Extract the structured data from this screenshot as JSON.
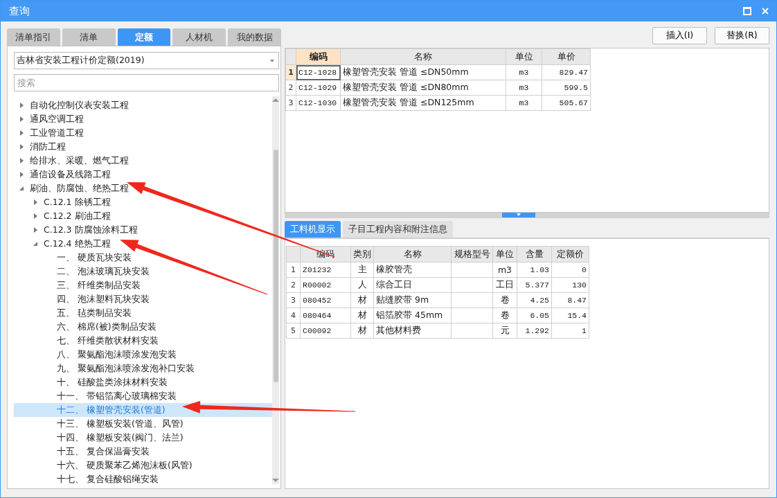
{
  "window": {
    "title": "查询"
  },
  "left_tabs": [
    {
      "label": "清单指引",
      "selected": false
    },
    {
      "label": "清单",
      "selected": false
    },
    {
      "label": "定额",
      "selected": true
    },
    {
      "label": "人材机",
      "selected": false
    },
    {
      "label": "我的数据",
      "selected": false
    }
  ],
  "library_select": {
    "value": "吉林省安装工程计价定额(2019)"
  },
  "search": {
    "placeholder": "搜索"
  },
  "tree": [
    {
      "label": "自动化控制仪表安装工程",
      "expanded": false,
      "selected": false
    },
    {
      "label": "通风空调工程",
      "expanded": false,
      "selected": false
    },
    {
      "label": "工业管道工程",
      "expanded": false,
      "selected": false
    },
    {
      "label": "消防工程",
      "expanded": false,
      "selected": false
    },
    {
      "label": "给排水、采暖、燃气工程",
      "expanded": false,
      "selected": false
    },
    {
      "label": "通信设备及线路工程",
      "expanded": false,
      "selected": false
    },
    {
      "label": "刷油、防腐蚀、绝热工程",
      "expanded": true,
      "selected": false,
      "children": [
        {
          "label": "C.12.1 除锈工程",
          "expanded": false,
          "selected": false
        },
        {
          "label": "C.12.2 刷油工程",
          "expanded": false,
          "selected": false
        },
        {
          "label": "C.12.3 防腐蚀涂料工程",
          "expanded": false,
          "selected": false
        },
        {
          "label": "C.12.4 绝热工程",
          "expanded": true,
          "selected": false,
          "children": [
            {
              "label": "一、 硬质瓦块安装",
              "selected": false
            },
            {
              "label": "二、 泡沫玻璃瓦块安装",
              "selected": false
            },
            {
              "label": "三、 纤维类制品安装",
              "selected": false
            },
            {
              "label": "四、 泡沫塑料瓦块安装",
              "selected": false
            },
            {
              "label": "五、 毡类制品安装",
              "selected": false
            },
            {
              "label": "六、 棉席(被)类制品安装",
              "selected": false
            },
            {
              "label": "七、 纤维类散状材料安装",
              "selected": false
            },
            {
              "label": "八、 聚氨酯泡沫喷涂发泡安装",
              "selected": false
            },
            {
              "label": "九、 聚氨酯泡沫喷涂发泡补口安装",
              "selected": false
            },
            {
              "label": "十、 硅酸盐类涂抹材料安装",
              "selected": false
            },
            {
              "label": "十一、 带铝箔离心玻璃棉安装",
              "selected": false
            },
            {
              "label": "十二、 橡塑管壳安装(管道)",
              "selected": true
            },
            {
              "label": "十三、 橡塑板安装(管道、风管)",
              "selected": false
            },
            {
              "label": "十四、 橡塑板安装(阀门、法兰)",
              "selected": false
            },
            {
              "label": "十五、 复合保温膏安装",
              "selected": false
            },
            {
              "label": "十六、 硬质聚苯乙烯泡沫板(风管)",
              "selected": false
            },
            {
              "label": "十七、 复合硅酸铝绳安装",
              "selected": false
            }
          ]
        }
      ]
    }
  ],
  "actions": [
    "插入(I)",
    "替换(R)"
  ],
  "quota_table": {
    "columns": [
      "编码",
      "名称",
      "单位",
      "单价"
    ],
    "rows": [
      {
        "index": "1",
        "selected": true,
        "cells": [
          "C12-1028",
          "橡塑管壳安装 管道 ≤DN50mm",
          "m3",
          "829.47"
        ]
      },
      {
        "index": "2",
        "selected": false,
        "cells": [
          "C12-1029",
          "橡塑管壳安装 管道 ≤DN80mm",
          "m3",
          "599.5"
        ]
      },
      {
        "index": "3",
        "selected": false,
        "cells": [
          "C12-1030",
          "橡塑管壳安装 管道 ≤DN125mm",
          "m3",
          "505.67"
        ]
      }
    ]
  },
  "detail_tabs": [
    {
      "label": "工料机显示",
      "selected": true
    },
    {
      "label": "子目工程内容和附注信息",
      "selected": false
    }
  ],
  "resource_table": {
    "columns": [
      "编码",
      "类别",
      "名称",
      "规格型号",
      "单位",
      "含量",
      "定额价"
    ],
    "rows": [
      {
        "index": "1",
        "code": "Z01232",
        "type": "主",
        "name": "橡胶管壳",
        "unit": "m3",
        "amount": "1.03",
        "price": "0"
      },
      {
        "index": "2",
        "code": "R00002",
        "type": "人",
        "name": "综合工日",
        "unit": "工日",
        "amount": "5.377",
        "price": "130"
      },
      {
        "index": "3",
        "code": "080452",
        "type": "材",
        "name": "贴缝胶带 9m",
        "unit": "卷",
        "amount": "4.25",
        "price": "8.47"
      },
      {
        "index": "4",
        "code": "080464",
        "type": "材",
        "name": "铝箔胶带 45mm",
        "unit": "卷",
        "amount": "6.05",
        "price": "15.4"
      },
      {
        "index": "5",
        "code": "C00092",
        "type": "材",
        "name": "其他材料费",
        "unit": "元",
        "amount": "1.292",
        "price": "1"
      }
    ]
  }
}
